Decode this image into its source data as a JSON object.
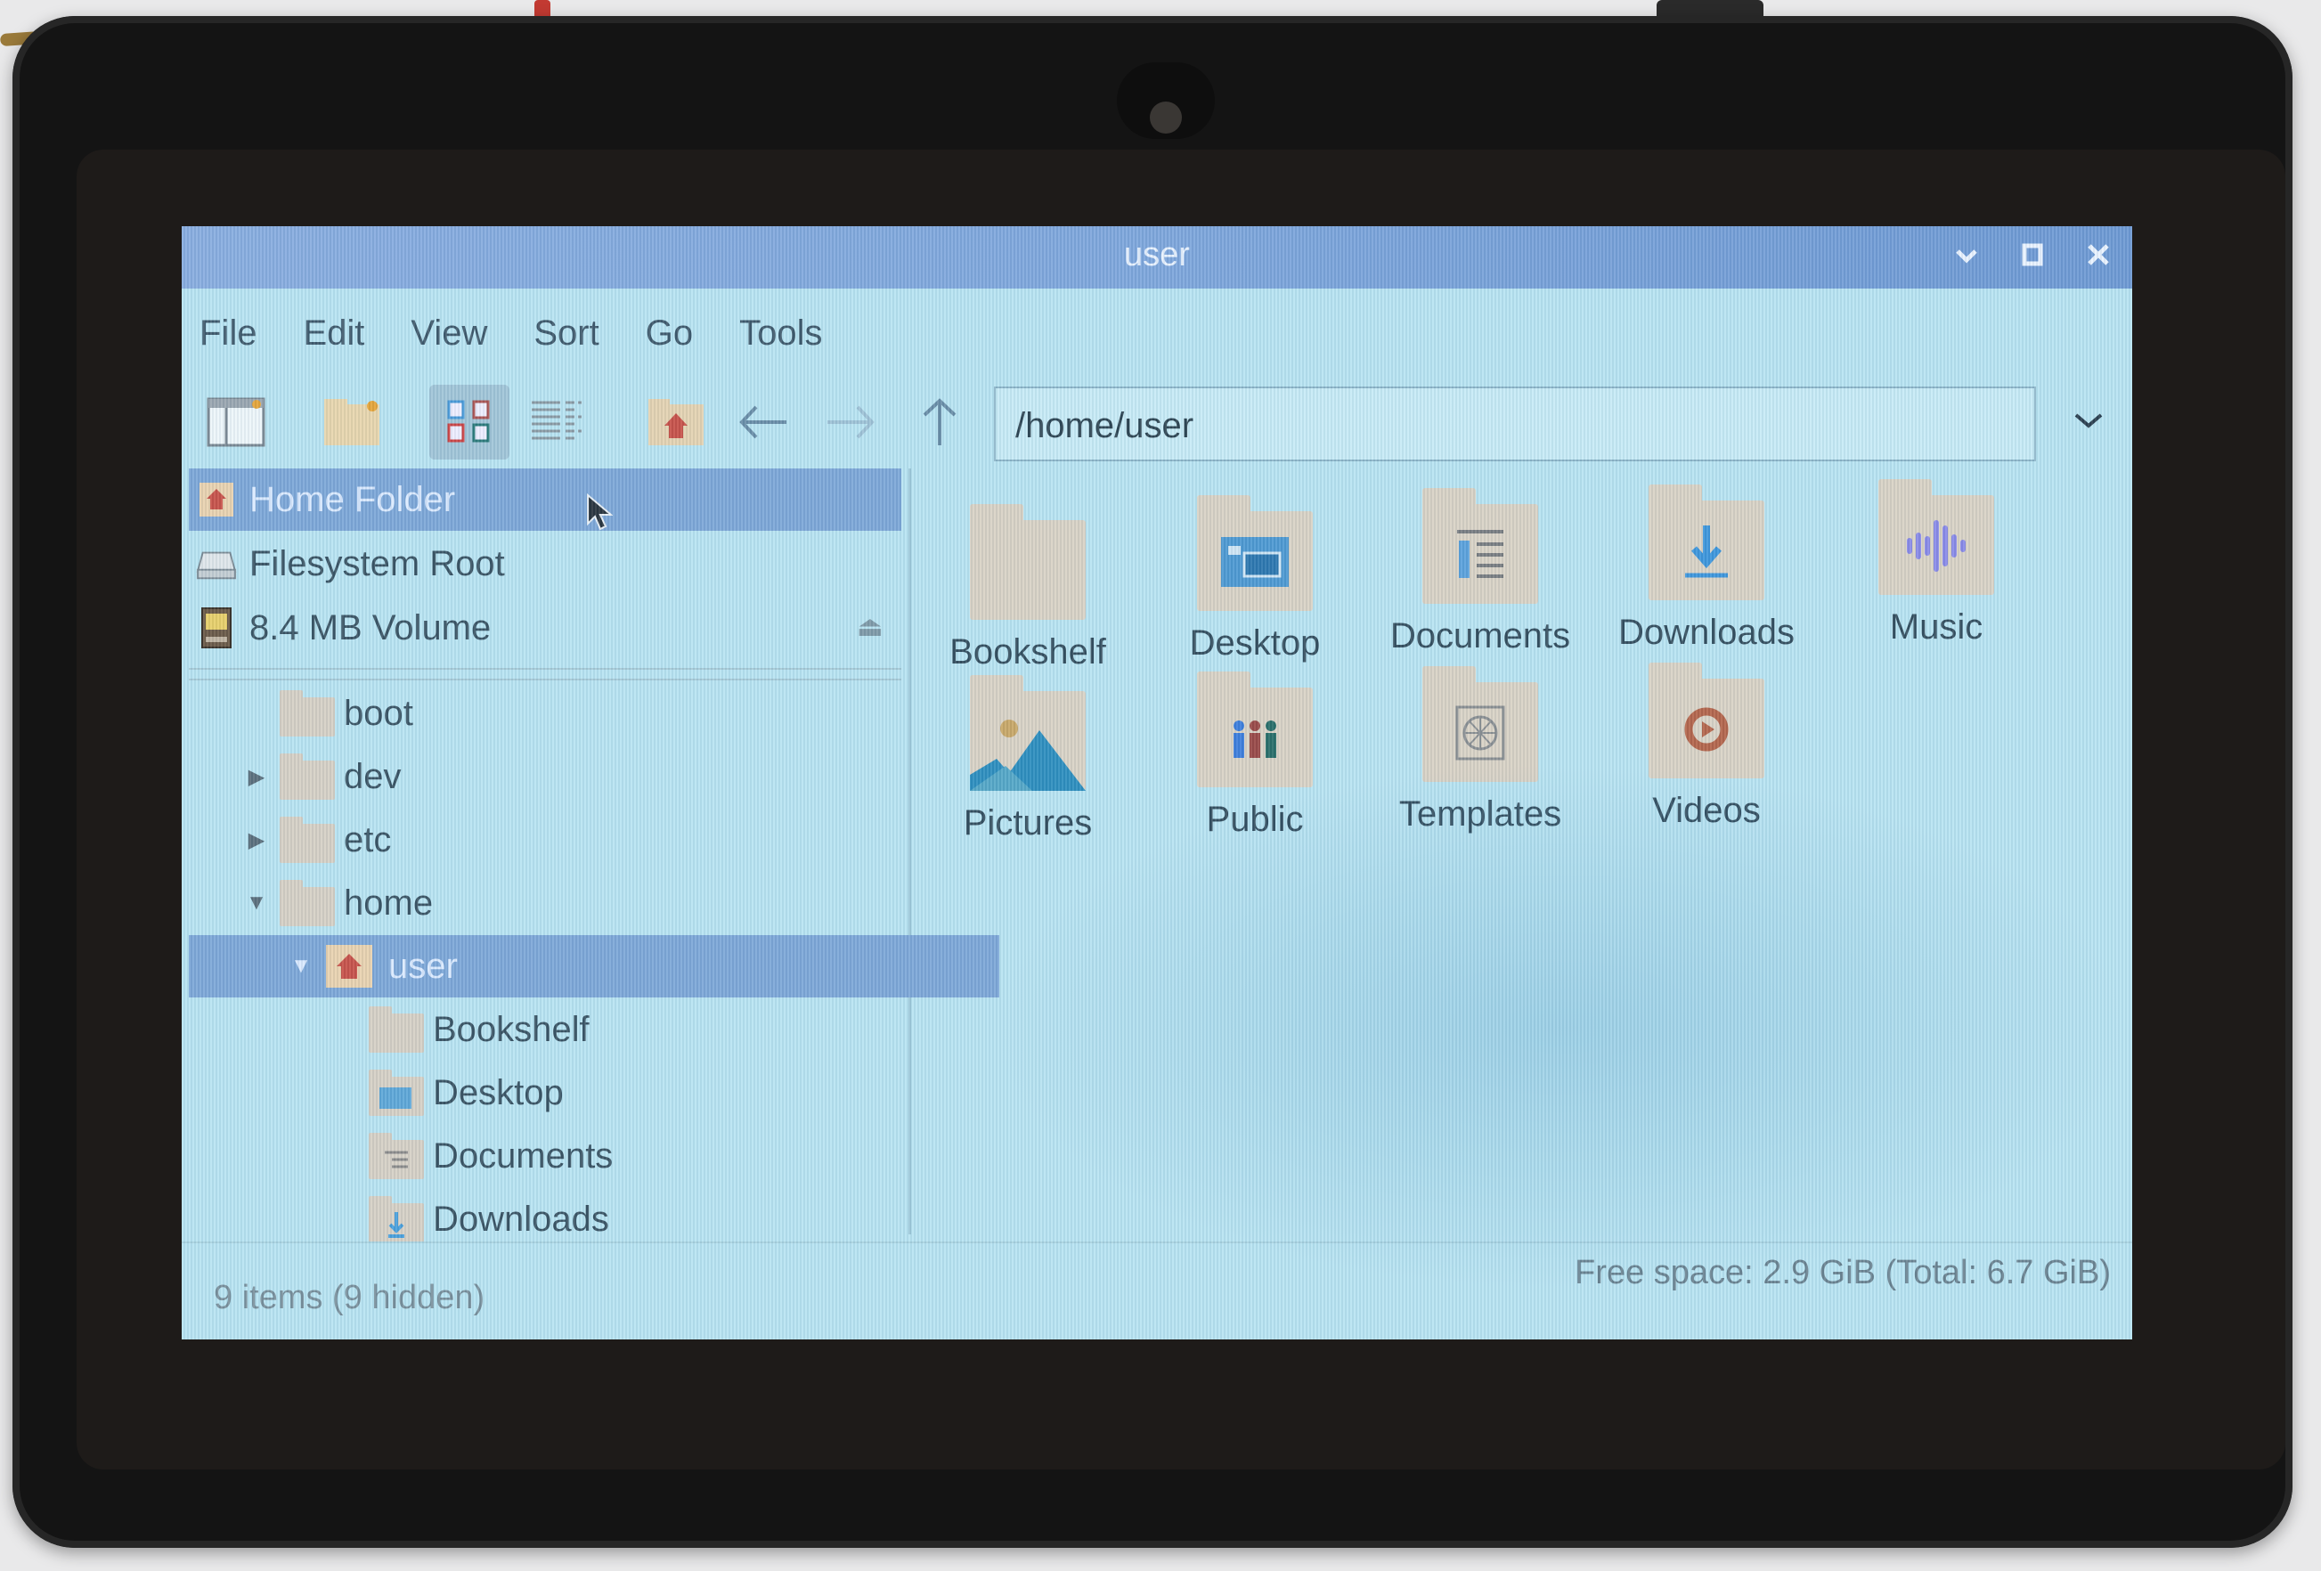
{
  "window": {
    "title": "user",
    "controls": [
      "minimize",
      "maximize",
      "close"
    ]
  },
  "menu": [
    "File",
    "Edit",
    "View",
    "Sort",
    "Go",
    "Tools"
  ],
  "toolbar": {
    "buttons": [
      {
        "name": "new-window",
        "icon": "window-icon"
      },
      {
        "name": "new-folder",
        "icon": "folder-new-icon"
      },
      {
        "name": "icon-view",
        "icon": "grid-icon",
        "active": true
      },
      {
        "name": "list-view",
        "icon": "list-icon"
      },
      {
        "name": "home",
        "icon": "home-folder-icon"
      },
      {
        "name": "back",
        "icon": "arrow-left-icon"
      },
      {
        "name": "forward",
        "icon": "arrow-right-icon",
        "disabled": true
      },
      {
        "name": "up",
        "icon": "arrow-up-icon"
      }
    ],
    "path": "/home/user"
  },
  "sidebar": {
    "places": [
      {
        "label": "Home Folder",
        "icon": "home-icon",
        "selected": true
      },
      {
        "label": "Filesystem Root",
        "icon": "drive-icon"
      },
      {
        "label": "8.4 MB Volume",
        "icon": "sd-card-icon",
        "eject": true
      }
    ],
    "tree": [
      {
        "label": "boot",
        "depth": 0,
        "expander": "none"
      },
      {
        "label": "dev",
        "depth": 0,
        "expander": "collapsed"
      },
      {
        "label": "etc",
        "depth": 0,
        "expander": "collapsed"
      },
      {
        "label": "home",
        "depth": 0,
        "expander": "expanded"
      },
      {
        "label": "user",
        "depth": 1,
        "expander": "expanded",
        "selected": true,
        "icon": "home-icon"
      },
      {
        "label": "Bookshelf",
        "depth": 2,
        "expander": "none"
      },
      {
        "label": "Desktop",
        "depth": 2,
        "expander": "none"
      },
      {
        "label": "Documents",
        "depth": 2,
        "expander": "none"
      },
      {
        "label": "Downloads",
        "depth": 2,
        "expander": "none"
      }
    ]
  },
  "items": [
    {
      "label": "Bookshelf",
      "emblem": "none"
    },
    {
      "label": "Desktop",
      "emblem": "desktop"
    },
    {
      "label": "Documents",
      "emblem": "document"
    },
    {
      "label": "Downloads",
      "emblem": "download"
    },
    {
      "label": "Music",
      "emblem": "music"
    },
    {
      "label": "Pictures",
      "emblem": "picture"
    },
    {
      "label": "Public",
      "emblem": "people"
    },
    {
      "label": "Templates",
      "emblem": "template"
    },
    {
      "label": "Videos",
      "emblem": "video"
    }
  ],
  "status": {
    "left": "9 items (9 hidden)",
    "right": "Free space: 2.9 GiB (Total: 6.7 GiB)"
  },
  "colors": {
    "titlebar": "#7fa7dc",
    "selection": "#7ea8d8",
    "screen_bg": "#b9e4f2",
    "folder": "#d9d2c6"
  }
}
